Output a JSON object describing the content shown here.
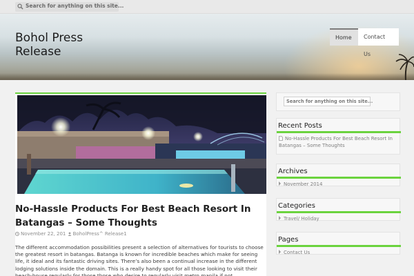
{
  "topbar": {
    "search_placeholder": "Search for anything on this site..."
  },
  "header": {
    "site_title_line1": "Bohol Press",
    "site_title_line2": "Release"
  },
  "nav": {
    "home": "Home",
    "contact": "Contact Us"
  },
  "post": {
    "title": "No-Hassle Products For Best Beach Resort In Batangas – Some Thoughts",
    "date": "November 22, 201",
    "author": "BoholPress^ Release1",
    "body": "The different accommodation possibilities present a selection of alternatives for tourists to choose the greatest resort in batangas. Batanga is known for incredible beaches which make for seeing life, it ideal and its fantastic driving sites. There’s also been a continual increase in the different lodging solutions inside the domain. This is a really handy spot for all those looking to visit their beach-house regularly for those those who desire to regularly visit metro manila if not. Nevertheless, this is likewise exactly why the"
  },
  "sidebar": {
    "search_placeholder": "Search for anything on this site...",
    "recent_posts": {
      "title": "Recent Posts",
      "items": [
        "No-Hassle Products For Best Beach Resort In Batangas – Some Thoughts"
      ]
    },
    "archives": {
      "title": "Archives",
      "items": [
        "November 2014"
      ]
    },
    "categories": {
      "title": "Categories",
      "items": [
        "Travel/ Holiday"
      ]
    },
    "pages": {
      "title": "Pages",
      "items": [
        "Contact Us"
      ]
    }
  },
  "colors": {
    "accent_green": "#6bd33e",
    "title_text": "#222222",
    "meta_text": "#8c8c8c"
  },
  "icons": [
    "search-icon",
    "clock-icon",
    "user-icon",
    "document-icon",
    "caret-right-icon",
    "palm-tree-icon"
  ]
}
